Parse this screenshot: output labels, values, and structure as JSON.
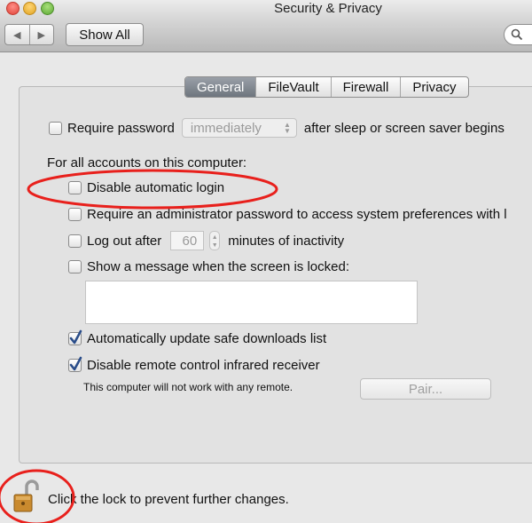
{
  "window": {
    "title": "Security & Privacy",
    "show_all_label": "Show All",
    "back_glyph": "◀",
    "forward_glyph": "▶"
  },
  "tabs": [
    {
      "label": "General",
      "active": true
    },
    {
      "label": "FileVault",
      "active": false
    },
    {
      "label": "Firewall",
      "active": false
    },
    {
      "label": "Privacy",
      "active": false
    }
  ],
  "general": {
    "require_password": {
      "label": "Require password",
      "checked": false
    },
    "require_password_delay": "immediately",
    "after_sleep_text": "after sleep or screen saver begins",
    "all_accounts_heading": "For all accounts on this computer:",
    "disable_auto_login": {
      "label": "Disable automatic login",
      "checked": false
    },
    "require_admin": {
      "label": "Require an administrator password to access system preferences with l",
      "checked": false
    },
    "log_out_after": {
      "label": "Log out after",
      "checked": false
    },
    "log_out_minutes": "60",
    "minutes_inactivity_text": "minutes of inactivity",
    "show_message": {
      "label": "Show a message when the screen is locked:",
      "checked": false
    },
    "message_text": "",
    "auto_update_downloads": {
      "label": "Automatically update safe downloads list",
      "checked": true
    },
    "disable_infrared": {
      "label": "Disable remote control infrared receiver",
      "checked": true
    },
    "remote_note": "This computer will not work with any remote.",
    "pair_button_label": "Pair..."
  },
  "footer": {
    "lock_text": "Click the lock to prevent further changes."
  },
  "colors": {
    "annotation": "#e8201c",
    "tab_active": "#7f868f",
    "checkmark": "#2a4d8a"
  },
  "icons": {
    "lock": "unlocked-padlock-icon",
    "search": "magnifier-icon"
  }
}
